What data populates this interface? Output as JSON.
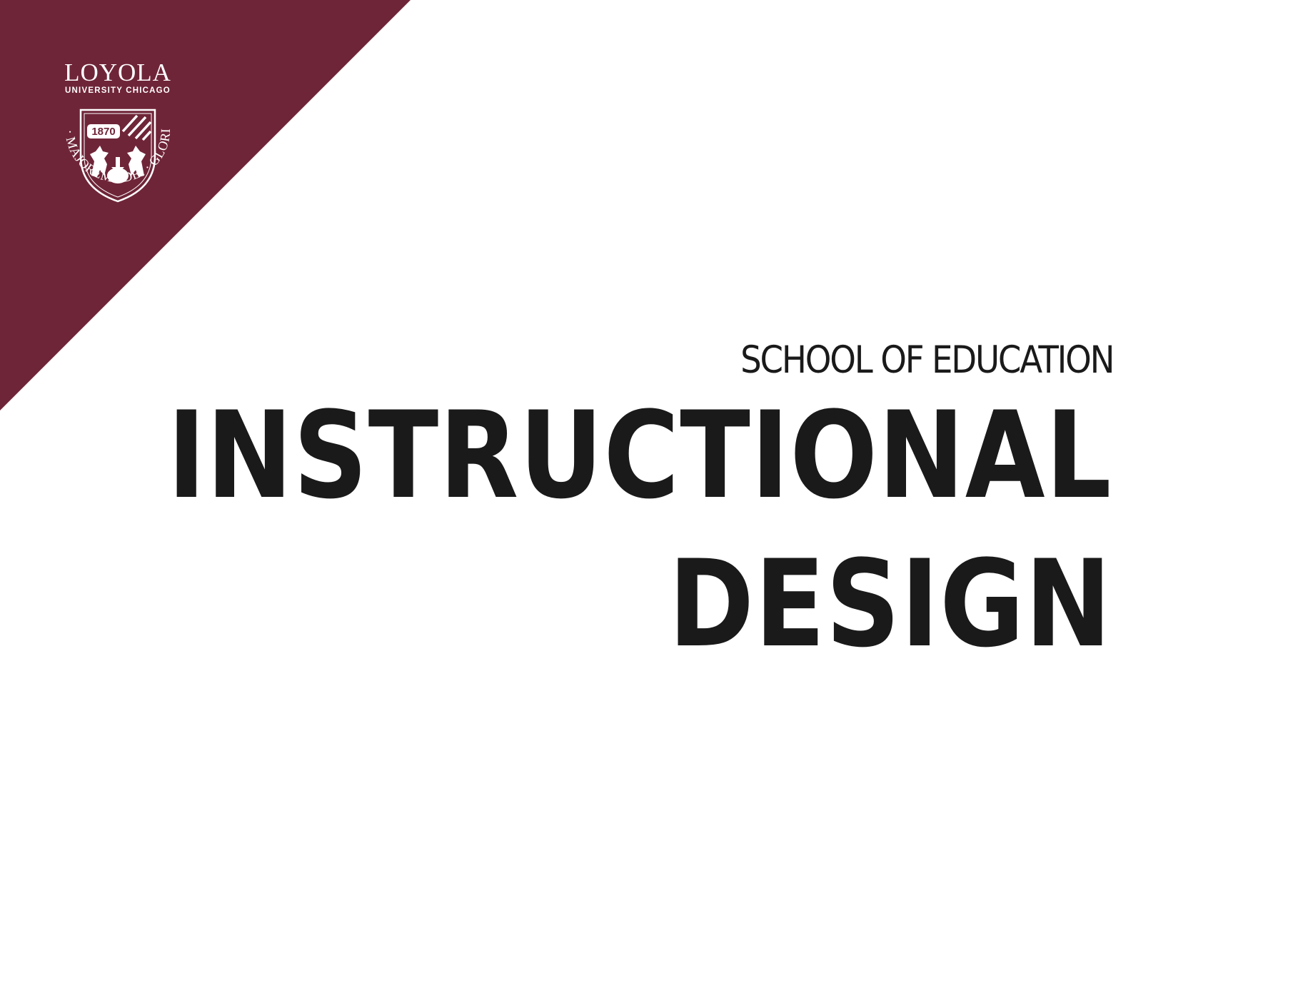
{
  "brand": {
    "accent_color": "#6f2538",
    "wordmark": "LOYOLA",
    "subline": "UNIVERSITY CHICAGO",
    "seal_year": "1870",
    "seal_motto": "AD · MAJOREM · DEI · GLORIAM"
  },
  "header": {
    "school": "SCHOOL OF EDUCATION",
    "title_line_1": "INSTRUCTIONAL",
    "title_line_2": "DESIGN"
  }
}
